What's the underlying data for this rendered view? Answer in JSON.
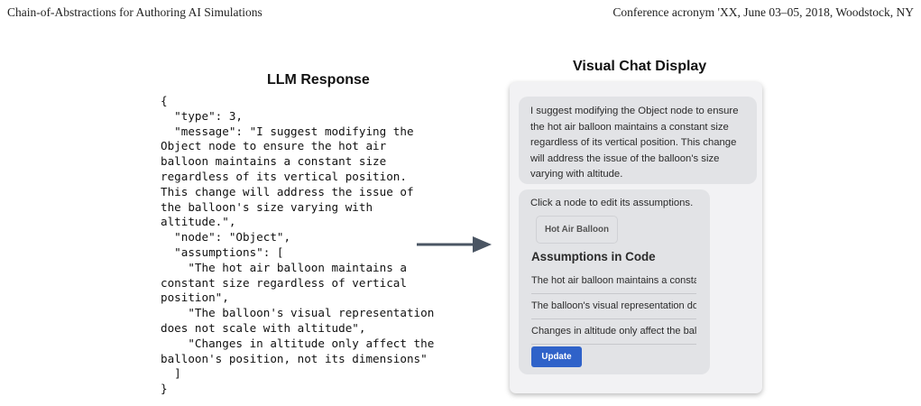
{
  "running_header": {
    "left": "Chain-of-Abstractions for Authoring AI Simulations",
    "right": "Conference acronym 'XX, June 03–05, 2018, Woodstock, NY"
  },
  "llm_panel": {
    "title": "LLM Response",
    "code_lines": [
      "{",
      "  \"type\": 3,",
      "  \"message\": \"I suggest modifying the",
      "Object node to ensure the hot air",
      "balloon maintains a constant size",
      "regardless of its vertical position.",
      "This change will address the issue of",
      "the balloon's size varying with",
      "altitude.\",",
      "  \"node\": \"Object\",",
      "  \"assumptions\": [",
      "    \"The hot air balloon maintains a",
      "constant size regardless of vertical",
      "position\",",
      "    \"The balloon's visual representation",
      "does not scale with altitude\",",
      "    \"Changes in altitude only affect the",
      "balloon's position, not its dimensions\"",
      "  ]",
      "}"
    ]
  },
  "visual_panel": {
    "title": "Visual Chat Display",
    "message": "I suggest modifying the Object node to ensure the hot air balloon maintains a constant size regardless of its vertical position. This change will address the issue of the balloon's size varying with altitude.",
    "edit_instruction": "Click a node to edit its assumptions.",
    "node_chip": "Hot Air Balloon",
    "assumptions_heading": "Assumptions in Code",
    "assumptions": [
      "The hot air balloon maintains a constant size regardless of vertical position",
      "The balloon's visual representation does not scale with altitude",
      "Changes in altitude only affect the balloon's position, not its dimensions"
    ],
    "update_label": "Update"
  },
  "colors": {
    "accent": "#2f62c9",
    "arrow": "#4a5563",
    "bubble": "#e2e3e6",
    "window": "#f2f2f4"
  }
}
